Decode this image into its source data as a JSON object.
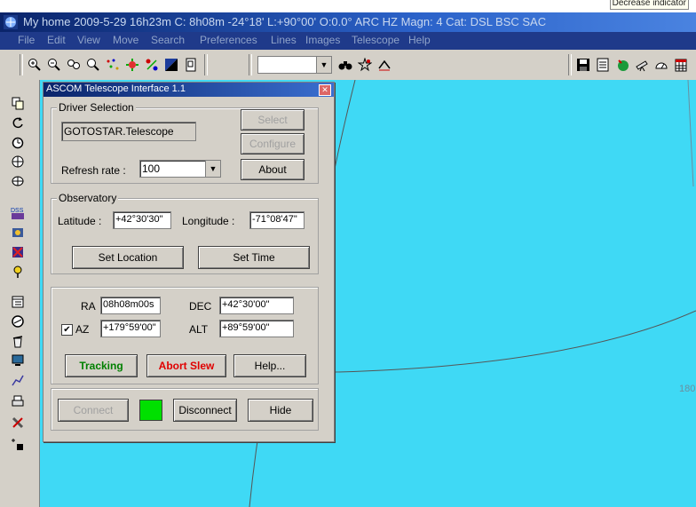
{
  "tooltip": "Decrease indicator",
  "window": {
    "title": "My home 2009-5-29  16h23m C:  8h08m -24°18' L:+90°00' O:0.0° ARC HZ  Magn: 4 Cat: DSL BSC SAC"
  },
  "menu": [
    "File",
    "Edit",
    "View",
    "Move",
    "Search",
    "Preferences",
    "Lines",
    "Images",
    "Telescope",
    "Help"
  ],
  "sky": {
    "coord_label": "180"
  },
  "dialog": {
    "title": "ASCOM Telescope Interface 1.1",
    "driver": {
      "legend": "Driver Selection",
      "name": "GOTOSTAR.Telescope",
      "select_label": "Select",
      "configure_label": "Configure",
      "about_label": "About",
      "refresh_label": "Refresh rate :",
      "refresh_value": "100"
    },
    "observatory": {
      "legend": "Observatory",
      "latitude_label": "Latitude :",
      "latitude_value": "+42°30'30\"",
      "longitude_label": "Longitude :",
      "longitude_value": "-71°08'47\"",
      "set_location_label": "Set Location",
      "set_time_label": "Set Time"
    },
    "coords": {
      "ra_label": "RA",
      "ra_value": "08h08m00s",
      "dec_label": "DEC",
      "dec_value": "+42°30'00\"",
      "az_label": "AZ",
      "az_value": "+179°59'00\"",
      "alt_label": "ALT",
      "alt_value": "+89°59'00\"",
      "az_checked": true
    },
    "actions": {
      "tracking_label": "Tracking",
      "abort_label": "Abort Slew",
      "help_label": "Help..."
    },
    "connection": {
      "connect_label": "Connect",
      "disconnect_label": "Disconnect",
      "hide_label": "Hide",
      "status_color": "#00e000"
    }
  },
  "colors": {
    "sky": "#3fd9f5",
    "tracking": "#008000",
    "abort": "#e00000"
  }
}
